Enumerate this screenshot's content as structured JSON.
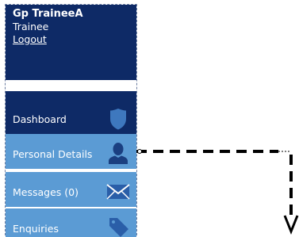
{
  "user": {
    "name": "Gp TraineeA",
    "role": "Trainee",
    "logout_label": "Logout"
  },
  "nav": {
    "items": [
      {
        "label": "Dashboard",
        "icon": "shield-icon"
      },
      {
        "label": "Personal Details",
        "icon": "person-icon"
      },
      {
        "label": "Messages (0)",
        "icon": "envelope-icon"
      },
      {
        "label": "Enquiries",
        "icon": "tag-icon"
      }
    ]
  },
  "colors": {
    "dark_navy": "#0e2a66",
    "light_blue": "#5b9bd4",
    "icon_blue": "#3e78be",
    "icon_dark": "#1a3f80",
    "arrow": "#000000"
  }
}
